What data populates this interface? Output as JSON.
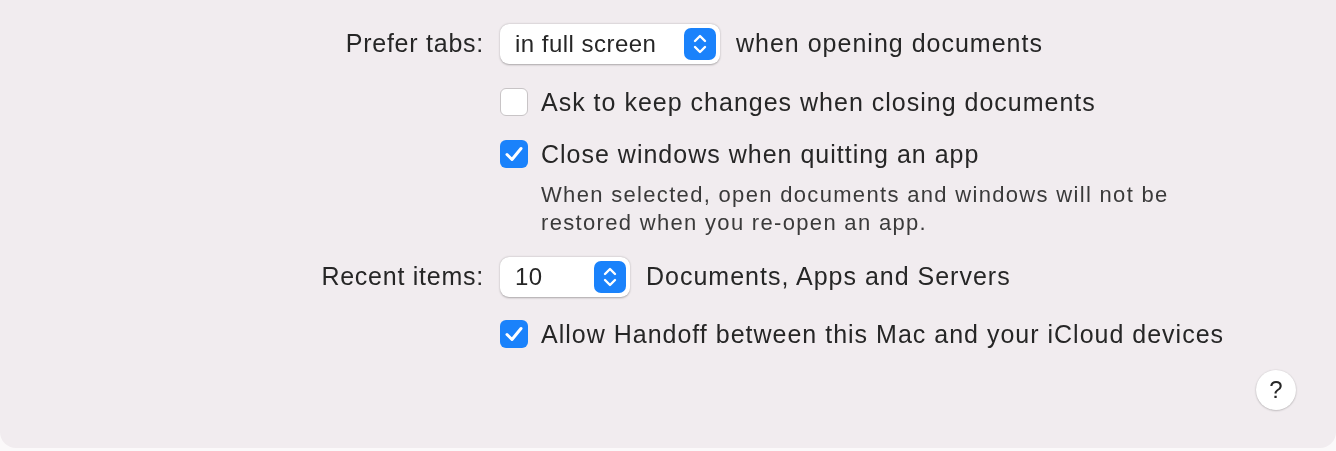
{
  "rows": [
    {
      "kind": "popup",
      "label": "Prefer tabs:",
      "value": "in full screen",
      "suffix": "when opening documents"
    },
    {
      "kind": "checkbox",
      "text": "Ask to keep changes when closing documents",
      "checked": false
    },
    {
      "kind": "checkbox",
      "text": "Close windows when quitting an app",
      "checked": true,
      "description": "When selected, open documents and windows will not be restored when you re-open an app."
    },
    {
      "kind": "popup",
      "label": "Recent items:",
      "value": "10",
      "suffix": "Documents, Apps and Servers"
    },
    {
      "kind": "checkbox",
      "text": "Allow Handoff between this Mac and your iCloud devices",
      "checked": true
    }
  ],
  "help_button": "?"
}
